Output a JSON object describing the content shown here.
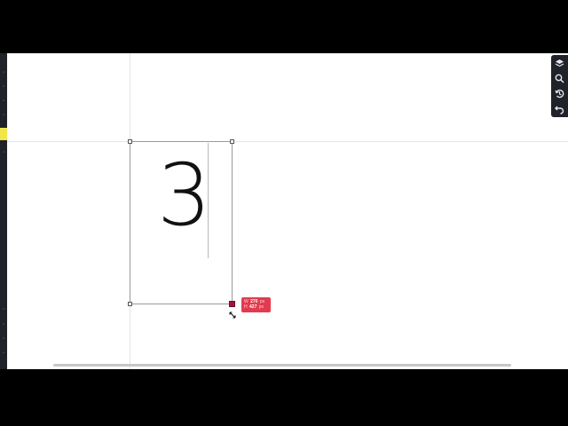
{
  "left_toolbar": {
    "tools": [
      {
        "name": "tool-1"
      },
      {
        "name": "tool-2"
      },
      {
        "name": "tool-3"
      },
      {
        "name": "tool-4"
      },
      {
        "name": "tool-5"
      },
      {
        "name": "tool-6"
      },
      {
        "name": "tool-7"
      },
      {
        "name": "tool-8"
      },
      {
        "name": "tool-9"
      },
      {
        "name": "tool-10"
      }
    ]
  },
  "right_toolbar": {
    "icons": [
      "layers-icon",
      "search-icon",
      "history-icon",
      "undo-icon"
    ]
  },
  "artboard": {
    "glyph": "3"
  },
  "size_tooltip": {
    "width_label": "W",
    "width_value": "270",
    "width_unit": "px",
    "height_label": "H",
    "height_value": "427",
    "height_unit": "px"
  },
  "colors": {
    "tooltip_bg": "#e23b4f",
    "toolbar_bg": "#1f2228",
    "active_tool": "#f0e64a",
    "handle_accent": "#a4123f"
  }
}
